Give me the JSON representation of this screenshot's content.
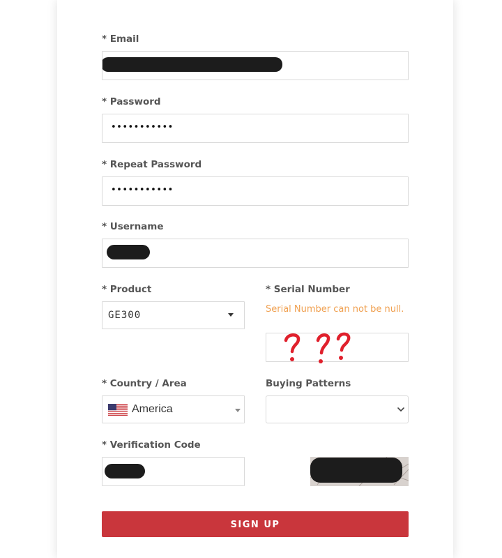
{
  "form": {
    "email": {
      "label": "* Email",
      "value": ""
    },
    "password": {
      "label": "* Password",
      "value": "•••••••••••"
    },
    "repeat_password": {
      "label": "* Repeat Password",
      "value": "•••••••••••"
    },
    "username": {
      "label": "* Username",
      "value": ""
    },
    "product": {
      "label": "* Product",
      "value": "GE300"
    },
    "serial_number": {
      "label": "* Serial Number",
      "error": "Serial Number can not be null.",
      "value": ""
    },
    "country": {
      "label": "* Country / Area",
      "value": "America",
      "flag": "us-flag-icon"
    },
    "buying_patterns": {
      "label": "Buying Patterns",
      "value": ""
    },
    "verification_code": {
      "label": "* Verification Code",
      "value": ""
    },
    "submit_label": "SIGN UP"
  },
  "colors": {
    "accent": "#c9363c",
    "error": "#f0a050",
    "label": "#555555",
    "border": "#d9d9d9",
    "annotation": "#e0202c"
  }
}
